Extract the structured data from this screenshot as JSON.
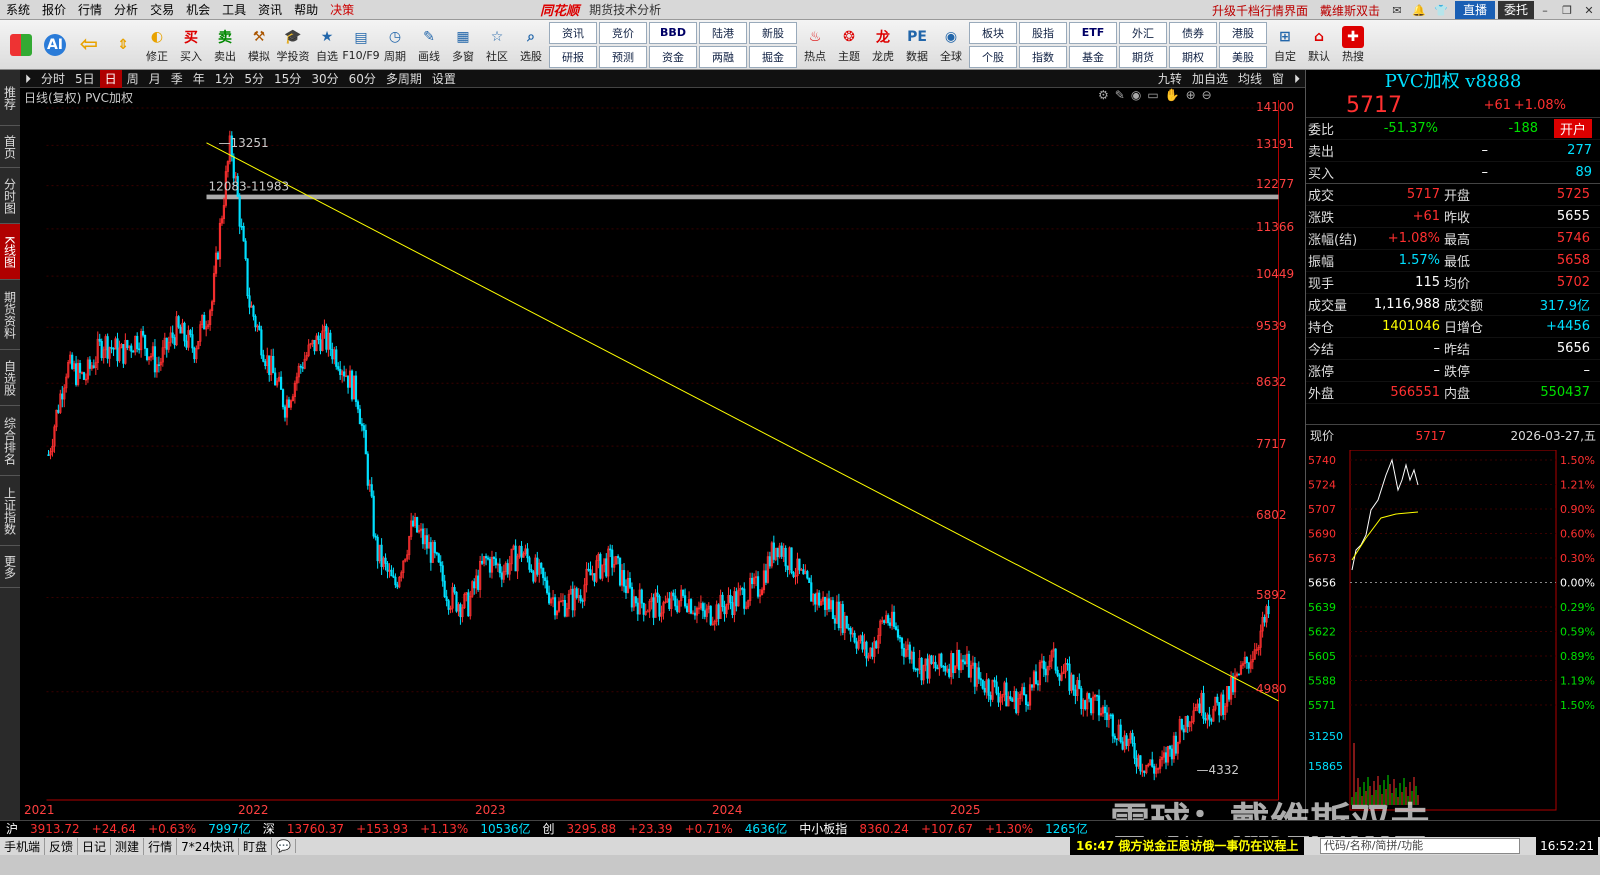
{
  "menubar": {
    "items": [
      "系统",
      "报价",
      "行情",
      "分析",
      "交易",
      "机会",
      "工具",
      "资讯",
      "帮助",
      "决策"
    ],
    "logo": "同花顺",
    "subtitle": "期货技术分析",
    "upgrade": "升级千档行情界面",
    "user_link": "戴维斯双击",
    "live": "直播",
    "account": "委托"
  },
  "toolbar": {
    "buttons": [
      "修正",
      "买入",
      "卖出",
      "模拟",
      "学投资",
      "自选",
      "F10/F9",
      "周期",
      "画线",
      "多窗",
      "社区",
      "选股"
    ],
    "grid1": [
      "资讯",
      "竞价",
      "研报",
      "预测"
    ],
    "grid2": [
      "BBD",
      "陆港",
      "资金",
      "两融"
    ],
    "grid3": [
      "新股",
      "掘金"
    ],
    "buttons2": [
      "热点",
      "主题",
      "龙虎",
      "数据",
      "全球"
    ],
    "grid4": [
      "板块",
      "股指",
      "个股",
      "指数"
    ],
    "grid5": [
      "ETF",
      "外汇",
      "基金",
      "期货"
    ],
    "grid6": [
      "债券",
      "港股",
      "期权",
      "美股"
    ],
    "buttons3": [
      "自定",
      "默认",
      "热搜"
    ]
  },
  "lefttabs": [
    "推荐",
    "首页",
    "分时图",
    "K线图",
    "期货资料",
    "自选股",
    "综合排名",
    "上证指数",
    "更多"
  ],
  "periodbar": {
    "items": [
      "分时",
      "5日",
      "日",
      "周",
      "月",
      "季",
      "年",
      "1分",
      "5分",
      "15分",
      "30分",
      "60分",
      "多周期",
      "设置"
    ],
    "right": [
      "九转",
      "加自选",
      "均线",
      "窗"
    ]
  },
  "chart": {
    "title": "日线(复权) PVC加权",
    "y_labels": [
      "14100",
      "13191",
      "12277",
      "11366",
      "10449",
      "9539",
      "8632",
      "7717",
      "6802",
      "5892",
      "4980"
    ],
    "x_labels": [
      "2021",
      "2022",
      "2023",
      "2024",
      "2025"
    ],
    "high_label": "13251",
    "low_label": "4332",
    "band_label": "12083-11983"
  },
  "chart_data": {
    "type": "candlestick",
    "x_range": [
      "2021",
      "2026"
    ],
    "ylim": [
      4332,
      14100
    ],
    "max": 13251,
    "min": 4332,
    "band": [
      11983,
      12083
    ],
    "trendline": [
      {
        "x": "2021-10",
        "y": 13251
      },
      {
        "x": "2026-03",
        "y": 4900
      }
    ],
    "series_close": [
      7600,
      8900,
      8700,
      9300,
      9100,
      9400,
      8900,
      9500,
      9200,
      10000,
      13251,
      10000,
      9000,
      8300,
      9000,
      9400,
      9000,
      8400,
      6400,
      6000,
      6700,
      6400,
      5900,
      5800,
      6300,
      6200,
      6400,
      6100,
      5800,
      5900,
      6200,
      6300,
      5900,
      5800,
      5800,
      5900,
      5700,
      5800,
      5900,
      6000,
      6500,
      6200,
      5900,
      5800,
      5600,
      5300,
      5700,
      5400,
      5200,
      5200,
      5300,
      5100,
      5000,
      4900,
      5000,
      5300,
      5100,
      4900,
      4800,
      4600,
      4400,
      4332,
      4600,
      4900,
      4800,
      5000,
      5300,
      5717
    ],
    "candles_note": "daily OHLC approximated"
  },
  "right": {
    "title": "PVC加权 v8888",
    "price": "5717",
    "chg": "+61",
    "pct": "+1.08%",
    "weibi": {
      "l": "委比",
      "v": "-51.37%",
      "v2": "-188",
      "btn": "开户"
    },
    "sell": {
      "l": "卖出",
      "v": "–",
      "v2": "277"
    },
    "buy": {
      "l": "买入",
      "v": "–",
      "v2": "89"
    },
    "rows": [
      {
        "l": "成交",
        "v": "5717",
        "l2": "开盘",
        "v2": "5725"
      },
      {
        "l": "涨跌",
        "v": "+61",
        "l2": "昨收",
        "v2": "5655"
      },
      {
        "l": "涨幅(结)",
        "v": "+1.08%",
        "l2": "最高",
        "v2": "5746"
      },
      {
        "l": "振幅",
        "v": "1.57%",
        "l2": "最低",
        "v2": "5658"
      },
      {
        "l": "现手",
        "v": "115",
        "l2": "均价",
        "v2": "5702"
      },
      {
        "l": "成交量",
        "v": "1,116,988",
        "l2": "成交额",
        "v2": "317.9亿"
      },
      {
        "l": "持仓",
        "v": "1401046",
        "l2": "日增仓",
        "v2": "+4456"
      },
      {
        "l": "今结",
        "v": "–",
        "l2": "昨结",
        "v2": "5656"
      },
      {
        "l": "涨停",
        "v": "–",
        "l2": "跌停",
        "v2": "–"
      },
      {
        "l": "外盘",
        "v": "566551",
        "l2": "内盘",
        "v2": "550437"
      }
    ],
    "mini_head": {
      "l": "现价",
      "v": "5717",
      "date": "2026-03-27,五"
    },
    "mini_y": [
      "5740",
      "5724",
      "5707",
      "5690",
      "5673",
      "5656",
      "5639",
      "5622",
      "5605",
      "5588",
      "5571"
    ],
    "mini_pct": [
      "1.50%",
      "1.21%",
      "0.90%",
      "0.60%",
      "0.30%",
      "0.00%",
      "0.29%",
      "0.59%",
      "0.89%",
      "1.19%",
      "1.50%"
    ],
    "vol_labels": [
      "31250",
      "15865"
    ]
  },
  "status": {
    "sh": "沪",
    "sh_v": "3913.72",
    "sh_c": "+24.64",
    "sh_p": "+0.63%",
    "sh_a": "7997亿",
    "sz": "深",
    "sz_v": "13760.37",
    "sz_c": "+153.93",
    "sz_p": "+1.13%",
    "sz_a": "10536亿",
    "cy": "创",
    "cy_v": "3295.88",
    "cy_c": "+23.39",
    "cy_p": "+0.71%",
    "cy_a": "4636亿",
    "zx": "中小板指",
    "zx_v": "8360.24",
    "zx_c": "+107.67",
    "zx_p": "+1.30%",
    "zx_a": "1265亿"
  },
  "bottom": {
    "items": [
      "手机端",
      "反馈",
      "日记",
      "测建",
      "行情",
      "7*24快讯",
      "盯盘"
    ],
    "news": "16:47 俄方说金正恩访俄一事仍在议程上",
    "search": "代码/名称/简拼/功能",
    "clock": "16:52:21"
  },
  "watermark": "雪球：戴维斯双击",
  "colors": {
    "up": "#ff3030",
    "down": "#00e0ff",
    "trend": "#ffff00",
    "band": "#aaaaaa"
  }
}
